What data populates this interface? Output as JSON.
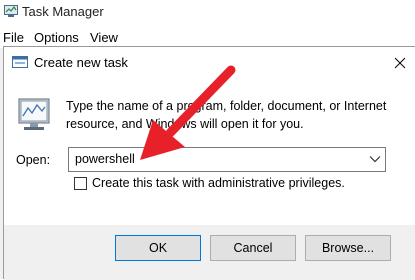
{
  "task_manager": {
    "title": "Task Manager",
    "menu": [
      "File",
      "Options",
      "View"
    ]
  },
  "dialog": {
    "title": "Create new task",
    "prompt": "Type the name of a program, folder, document, or Internet resource, and Windows will open it for you.",
    "open_label": "Open:",
    "open_value": "powershell",
    "admin_checkbox_label": "Create this task with administrative privileges.",
    "admin_checked": false,
    "buttons": {
      "ok": "OK",
      "cancel": "Cancel",
      "browse": "Browse..."
    }
  },
  "annotation": {
    "arrow_color": "#e8202a"
  },
  "colors": {
    "accent": "#0078d7",
    "footer_bg": "#f0f0f0"
  }
}
